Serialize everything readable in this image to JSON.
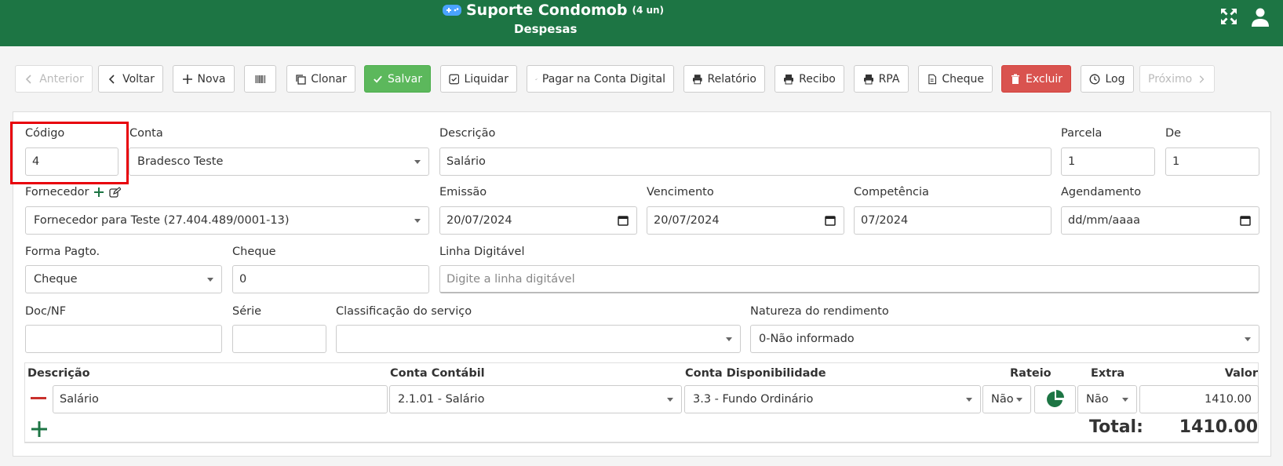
{
  "header": {
    "title": "Suporte Condomob",
    "units": "(4 un)",
    "subtitle": "Despesas"
  },
  "toolbar": {
    "anterior": "Anterior",
    "voltar": "Voltar",
    "nova": "Nova",
    "clonar": "Clonar",
    "salvar": "Salvar",
    "liquidar": "Liquidar",
    "pagar": "Pagar na Conta Digital",
    "relatorio": "Relatório",
    "recibo": "Recibo",
    "rpa": "RPA",
    "cheque": "Cheque",
    "excluir": "Excluir",
    "log": "Log",
    "proximo": "Próximo"
  },
  "form": {
    "codigo_label": "Código",
    "codigo_value": "4",
    "conta_label": "Conta",
    "conta_value": "Bradesco Teste",
    "descricao_label": "Descrição",
    "descricao_value": "Salário",
    "parcela_label": "Parcela",
    "parcela_value": "1",
    "de_label": "De",
    "de_value": "1",
    "fornecedor_label": "Fornecedor",
    "fornecedor_value": "Fornecedor para Teste (27.404.489/0001-13)",
    "emissao_label": "Emissão",
    "emissao_value": "20/07/2024",
    "vencimento_label": "Vencimento",
    "vencimento_value": "20/07/2024",
    "competencia_label": "Competência",
    "competencia_value": "07/2024",
    "agendamento_label": "Agendamento",
    "agendamento_value": "dd/mm/aaaa",
    "forma_label": "Forma Pagto.",
    "forma_value": "Cheque",
    "cheque_label": "Cheque",
    "cheque_value": "0",
    "linha_label": "Linha Digitável",
    "linha_placeholder": "Digite a linha digitável",
    "docnf_label": "Doc/NF",
    "serie_label": "Série",
    "classificacao_label": "Classificação do serviço",
    "natureza_label": "Natureza do rendimento",
    "natureza_value": "0-Não informado"
  },
  "items": {
    "headers": {
      "descricao": "Descrição",
      "conta_contabil": "Conta Contábil",
      "conta_disp": "Conta Disponibilidade",
      "rateio": "Rateio",
      "extra": "Extra",
      "valor": "Valor"
    },
    "rows": [
      {
        "descricao": "Salário",
        "conta_contabil": "2.1.01 - Salário",
        "conta_disp": "3.3 - Fundo Ordinário",
        "rateio": "Não",
        "extra": "Não",
        "valor": "1410.00"
      }
    ],
    "total_label": "Total:",
    "total_value": "1410.00"
  },
  "colors": {
    "brand": "#1d7544",
    "save": "#5cb85c",
    "delete": "#d9534f",
    "highlight": "#e8000b"
  }
}
